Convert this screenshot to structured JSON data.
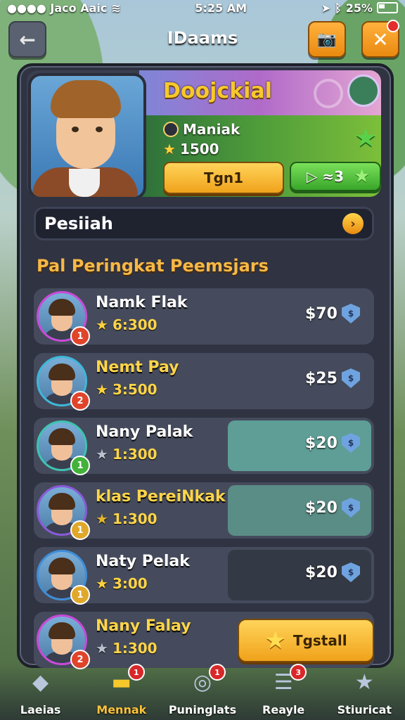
{
  "status_bar": {
    "carrier": "●●●● Jaco Aaic",
    "time": "5:25 AM",
    "battery": "25%"
  },
  "top_bar": {
    "title": "IDaams",
    "back_glyph": "←",
    "camera_glyph": "📷",
    "close_glyph": "✕"
  },
  "profile": {
    "name": "Doojckial",
    "status": "Maniak",
    "points": "1500",
    "primary_button": "Tgn1",
    "secondary_button": "▷ ≈3"
  },
  "search": {
    "label": "Pesiiah",
    "arrow_glyph": "›"
  },
  "leaderboard": {
    "title": "Pal Peringkat Peemsjars",
    "rows": [
      {
        "name": "Namk Flak",
        "score": "6:300",
        "rank": "1",
        "prize": "$70",
        "name_color": "#ffffff",
        "star_color": "#ffd23b",
        "tint": "",
        "ring": "#c94ad8",
        "rank_bg": "#e0442a"
      },
      {
        "name": "Nemt Pay",
        "score": "3:500",
        "rank": "2",
        "prize": "$25",
        "name_color": "#ffd54a",
        "star_color": "#ffd23b",
        "tint": "",
        "ring": "#3fb7d8",
        "rank_bg": "#e0442a"
      },
      {
        "name": "Nany Palak",
        "score": "1:300",
        "rank": "1",
        "prize": "$20",
        "name_color": "#ffffff",
        "star_color": "#b9c2cf",
        "tint": "#5e9e96",
        "ring": "#3fc3b0",
        "rank_bg": "#43b23a"
      },
      {
        "name": "klas PereiNkak",
        "score": "1:300",
        "rank": "1",
        "prize": "$20",
        "name_color": "#ffd54a",
        "star_color": "#e7b52b",
        "tint": "#5a8d86",
        "ring": "#8a5ad8",
        "rank_bg": "#e0a82a"
      },
      {
        "name": "Naty Pelak",
        "score": "3:00",
        "rank": "1",
        "prize": "$20",
        "name_color": "#ffffff",
        "star_color": "#ffd23b",
        "tint": "#343a45",
        "ring": "#3f8ed8",
        "rank_bg": "#e0a82a"
      },
      {
        "name": "Nany Falay",
        "score": "1:300",
        "rank": "2",
        "prize": "",
        "claim": "Tgstall",
        "name_color": "#ffd54a",
        "star_color": "#b9c2cf",
        "tint": "",
        "ring": "#c94ad8",
        "rank_bg": "#e0442a"
      }
    ]
  },
  "bottom_nav": [
    {
      "label": "Laeias",
      "glyph": "◆",
      "badge": "",
      "active": false
    },
    {
      "label": "Mennak",
      "glyph": "▬",
      "badge": "1",
      "active": true
    },
    {
      "label": "Puninglats",
      "glyph": "◎",
      "badge": "1",
      "active": false
    },
    {
      "label": "Reayle",
      "glyph": "☰",
      "badge": "3",
      "active": false
    },
    {
      "label": "Stiuricat",
      "glyph": "★",
      "badge": "",
      "active": false
    }
  ],
  "colors": {
    "accent_gold": "#f7c82b",
    "panel_bg": "#2f3342",
    "action_green": "#39a62a"
  }
}
